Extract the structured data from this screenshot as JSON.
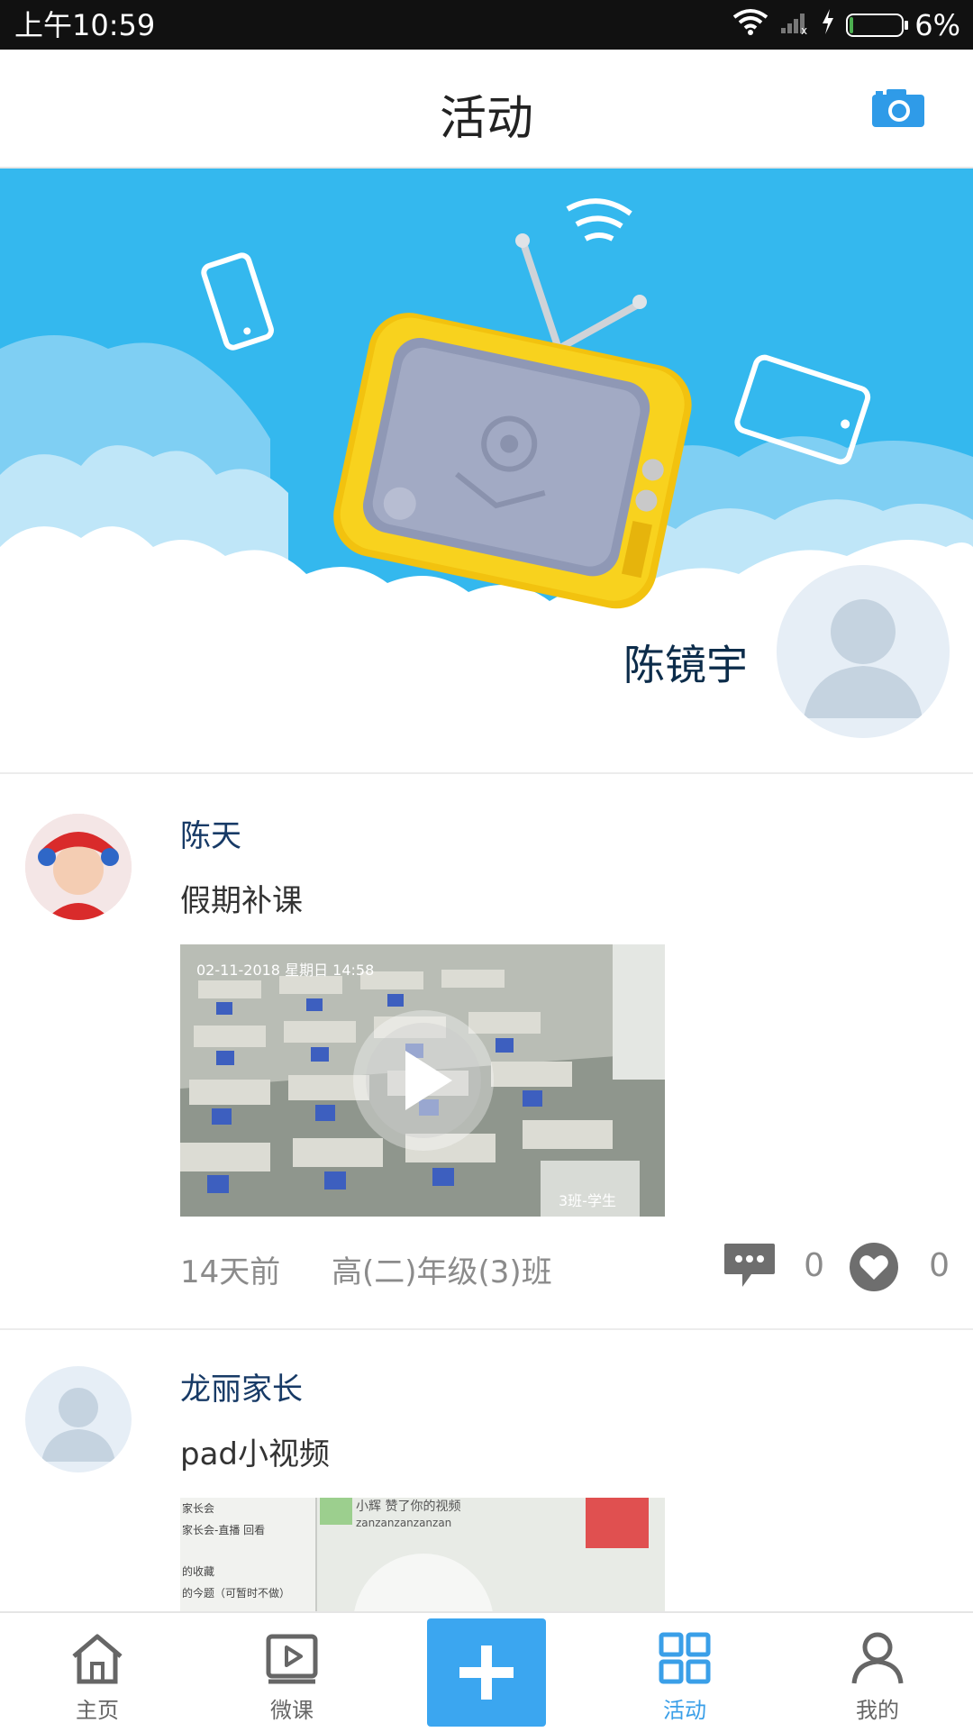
{
  "status_bar": {
    "time": "上午10:59",
    "battery_percent": "6%",
    "wifi_icon": "wifi-icon",
    "signal_icon": "signal-icon",
    "charging_icon": "charging-icon"
  },
  "header": {
    "title": "活动",
    "camera_icon": "camera-icon",
    "accent_color": "#2f9be8"
  },
  "banner": {
    "username": "陈镜宇",
    "illustration": "tv-illustration",
    "sky_color": "#34b8ee"
  },
  "posts": [
    {
      "author": "陈天",
      "text": "假期补课",
      "media_timestamp": "02-11-2018  星期日  14:58",
      "media_caption": "3班-学生",
      "time_ago": "14天前",
      "class_name": "高(二)年级(3)班",
      "comments": "0",
      "likes": "0"
    },
    {
      "author": "龙丽家长",
      "text": "pad小视频",
      "media_top_text": "小辉 赞了你的视频",
      "media_sub_text": "zanzanzanzanzan",
      "media_left_lines": [
        "家长会",
        "家长会-直播 回看",
        "的收藏",
        "的今题（可暂时不做）"
      ]
    }
  ],
  "bottom_nav": {
    "items": [
      {
        "label": "主页",
        "icon": "home-icon"
      },
      {
        "label": "微课",
        "icon": "video-icon"
      },
      {
        "label": "",
        "icon": "plus-icon"
      },
      {
        "label": "活动",
        "icon": "grid-icon"
      },
      {
        "label": "我的",
        "icon": "person-icon"
      }
    ],
    "active_index": 3,
    "active_color": "#3a9fe8"
  }
}
